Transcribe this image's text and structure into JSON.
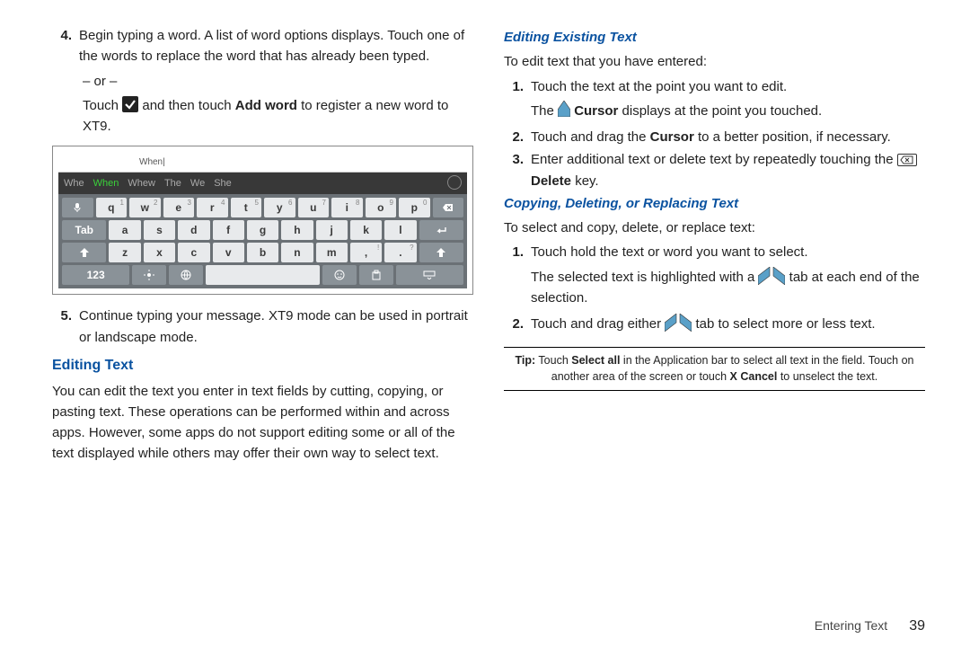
{
  "left": {
    "step4_n": "4.",
    "step4_a": "Begin typing a word. A list of word options displays. Touch one of the words to replace the word that has already been typed.",
    "or": "– or –",
    "step4_b_pre": "Touch ",
    "step4_b_mid": " and then touch ",
    "step4_b_bold": "Add word",
    "step4_b_post": " to register a new word to XT9.",
    "kb": {
      "typed": "When|",
      "sug": [
        "Whe",
        "When",
        "Whew",
        "The",
        "We",
        "She"
      ],
      "r1": [
        "q",
        "w",
        "e",
        "r",
        "t",
        "y",
        "u",
        "i",
        "o",
        "p"
      ],
      "r1s": [
        "1",
        "2",
        "3",
        "4",
        "5",
        "6",
        "7",
        "8",
        "9",
        "0"
      ],
      "r2": [
        "a",
        "s",
        "d",
        "f",
        "g",
        "h",
        "j",
        "k",
        "l"
      ],
      "r3": [
        "z",
        "x",
        "c",
        "v",
        "b",
        "n",
        "m"
      ],
      "r3punc": [
        ",",
        "!",
        "?",
        "."
      ],
      "tab": "Tab",
      "num": "123"
    },
    "step5_n": "5.",
    "step5": "Continue typing your message. XT9 mode can be used in portrait or landscape mode.",
    "h_edit": "Editing Text",
    "edit_p": "You can edit the text you enter in text fields by cutting, copying, or pasting text. These operations can be performed within and across apps. However, some apps do not support editing some or all of the text displayed while others may offer their own way to select text."
  },
  "right": {
    "h_exist": "Editing Existing Text",
    "exist_intro": "To edit text that you have entered:",
    "e1_n": "1.",
    "e1": "Touch the text at the point you want to edit.",
    "e1b_pre": "The ",
    "e1b_bold": " Cursor",
    "e1b_post": " displays at the point you touched.",
    "e2_n": "2.",
    "e2_pre": "Touch and drag the ",
    "e2_bold": "Cursor",
    "e2_post": " to a better position, if necessary.",
    "e3_n": "3.",
    "e3_pre": "Enter additional text or delete text by repeatedly touching the ",
    "e3_bold": " Delete",
    "e3_post": " key.",
    "h_copy": "Copying, Deleting, or Replacing Text",
    "copy_intro": "To select and copy, delete, or replace text:",
    "c1_n": "1.",
    "c1": "Touch hold the text or word you want to select.",
    "c1b_pre": "The selected text is highlighted with a ",
    "c1b_post": " tab at each end of the selection.",
    "c2_n": "2.",
    "c2_pre": "Touch and drag either ",
    "c2_post": " tab to select more or less text.",
    "tip_pre": "Tip:",
    "tip_a": "  Touch ",
    "tip_b1": "Select all",
    "tip_b": " in the Application bar to select all text in the field. Touch on another area of the screen or touch ",
    "tip_b2": "X Cancel",
    "tip_c": " to unselect the text."
  },
  "footer": {
    "section": "Entering Text",
    "page": "39"
  }
}
